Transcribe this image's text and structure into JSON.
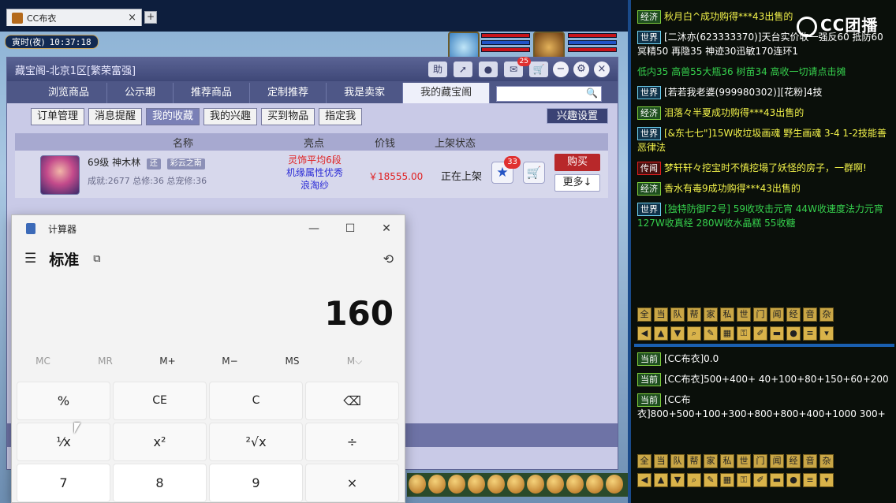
{
  "browser": {
    "tab_title": "CC布衣",
    "close": "×",
    "new_tab": "+"
  },
  "game_hud": {
    "time_label": "寅时(夜)",
    "time": "10:37:18"
  },
  "cbg": {
    "title": "藏宝阁-北京1区[繁荣富强]",
    "toolbar": {
      "help": "助",
      "msg_badge": "25"
    },
    "tabs": [
      "浏览商品",
      "公示期",
      "推荐商品",
      "定制推荐",
      "我是卖家",
      "我的藏宝阁"
    ],
    "subtabs": [
      "订单管理",
      "消息提醒",
      "我的收藏",
      "我的兴趣",
      "买到物品",
      "指定我"
    ],
    "interest_settings": "兴趣设置",
    "columns": {
      "name": "名称",
      "highlights": "亮点",
      "price": "价钱",
      "status": "上架状态"
    },
    "item": {
      "level_name": "69级  神木林",
      "tag1": "还",
      "tag2": "彩云之南",
      "stats": "成就:2677 总修:36 总宠修:36",
      "highlight1": "灵饰平均6段",
      "highlight2": "机缘属性优秀",
      "highlight3": "浪淘纱",
      "price": "￥18555.00",
      "status": "正在上架",
      "fav_count": "33",
      "buy": "购买",
      "more": "更多↓"
    }
  },
  "calculator": {
    "app_title": "计算器",
    "mode": "标准",
    "display": "160",
    "memory": [
      "MC",
      "MR",
      "M+",
      "M−",
      "MS",
      "M⌵"
    ],
    "keys": [
      "%",
      "CE",
      "C",
      "⌫",
      "¹⁄x",
      "x²",
      "²√x",
      "÷",
      "7",
      "8",
      "9",
      "×"
    ]
  },
  "chat": {
    "messages": [
      {
        "chan": "经济",
        "text": "秋月白^成功购得***43出售的",
        "style": "m-yellow"
      },
      {
        "chan": "世界",
        "text": "[二沐亦(623333370)]天台实价收一强反60 抵防60 冥精50 再隐35 神迹30迅敏170连环1",
        "style": "m-white"
      },
      {
        "chan": "",
        "text": "低内35 高兽55大瓶36 树苗34  高收一切请点击摊",
        "style": "m-green"
      },
      {
        "chan": "世界",
        "text": "[若若我老婆(999980302)][花粉]4技",
        "style": "m-white"
      },
      {
        "chan": "经济",
        "text": "泪落々半夏成功购得***43出售的",
        "style": "m-yellow"
      },
      {
        "chan": "世界",
        "text": "[&东七七\"]15W收垃圾画魂 野生画魂 3-4 1-2技能善恶律法",
        "style": "m-yellow"
      },
      {
        "chan": "传闻",
        "text": "梦轩轩々挖宝时不慎挖塌了妖怪的房子，一群啊!",
        "style": "m-yellow"
      },
      {
        "chan": "经济",
        "text": "香水有毒9成功购得***43出售的",
        "style": "m-yellow"
      },
      {
        "chan": "世界",
        "text": "[独特防御F2号]  59收攻击元宵 44W收速度法力元宵  127W收真经 280W收水晶糕 55收糖",
        "style": "m-green"
      }
    ],
    "bar_labels": [
      "全",
      "当",
      "队",
      "帮",
      "家",
      "私",
      "世",
      "门",
      "闻",
      "经",
      "音",
      "杂"
    ],
    "current_messages": [
      {
        "chan": "当前",
        "text": "[CC布衣]0.0"
      },
      {
        "chan": "当前",
        "text": "[CC布衣]500+400+  40+100+80+150+60+200"
      },
      {
        "chan": "当前",
        "text": "[CC布衣]800+500+100+300+800+800+400+1000 300+"
      }
    ],
    "watermark": "CC团播"
  }
}
